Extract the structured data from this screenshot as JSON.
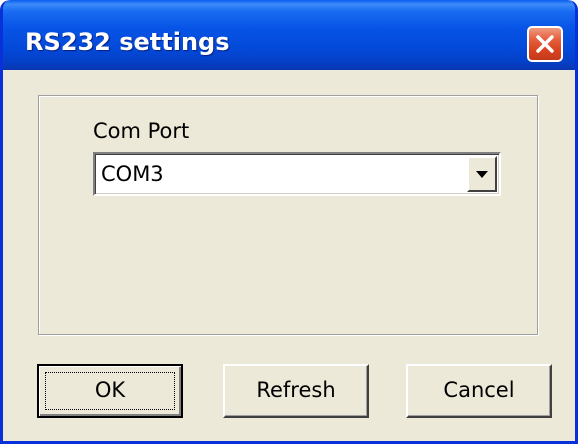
{
  "window": {
    "title": "RS232 settings"
  },
  "form": {
    "com_port_label": "Com Port",
    "com_port_value": "COM3"
  },
  "buttons": {
    "ok": "OK",
    "refresh": "Refresh",
    "cancel": "Cancel"
  },
  "icons": {
    "close": "close-icon",
    "dropdown": "chevron-down-icon"
  },
  "colors": {
    "titlebar": "#0754e6",
    "close_button": "#d8431f",
    "dialog_face": "#ece9d8"
  }
}
